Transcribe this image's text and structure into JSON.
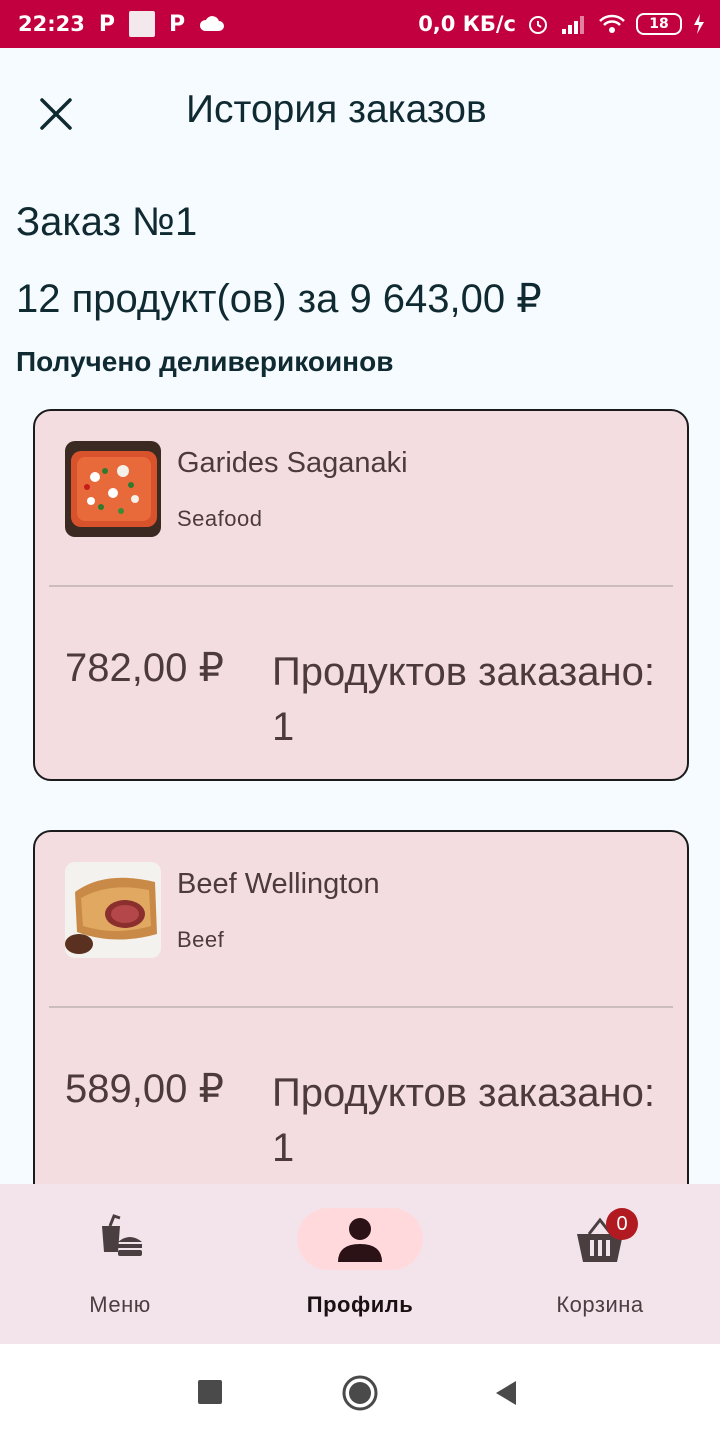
{
  "status_bar": {
    "time": "22:23",
    "left_icons": [
      "P",
      "P"
    ],
    "net_speed": "0,0 КБ/с",
    "battery": "18"
  },
  "header": {
    "title": "История заказов"
  },
  "order": {
    "title": "Заказ №1",
    "summary": "12 продукт(ов) за 9 643,00 ₽",
    "coins_label": "Получено деливерикоинов"
  },
  "items": [
    {
      "name": "Garides Saganaki",
      "category": "Seafood",
      "price": "782,00 ₽",
      "quantity": "Продуктов заказано: 1",
      "image": "garides-saganaki-photo"
    },
    {
      "name": "Beef Wellington",
      "category": "Beef",
      "price": "589,00 ₽",
      "quantity": "Продуктов заказано: 1",
      "image": "beef-wellington-photo"
    }
  ],
  "bottom_nav": {
    "menu": "Меню",
    "profile": "Профиль",
    "cart": "Корзина",
    "cart_badge": "0"
  },
  "colors": {
    "status_bar": "#c2003f",
    "card_bg": "#f3dde0",
    "nav_bg": "#f3e4ec",
    "active_pill": "#ffd9dc",
    "badge": "#b01a20"
  }
}
